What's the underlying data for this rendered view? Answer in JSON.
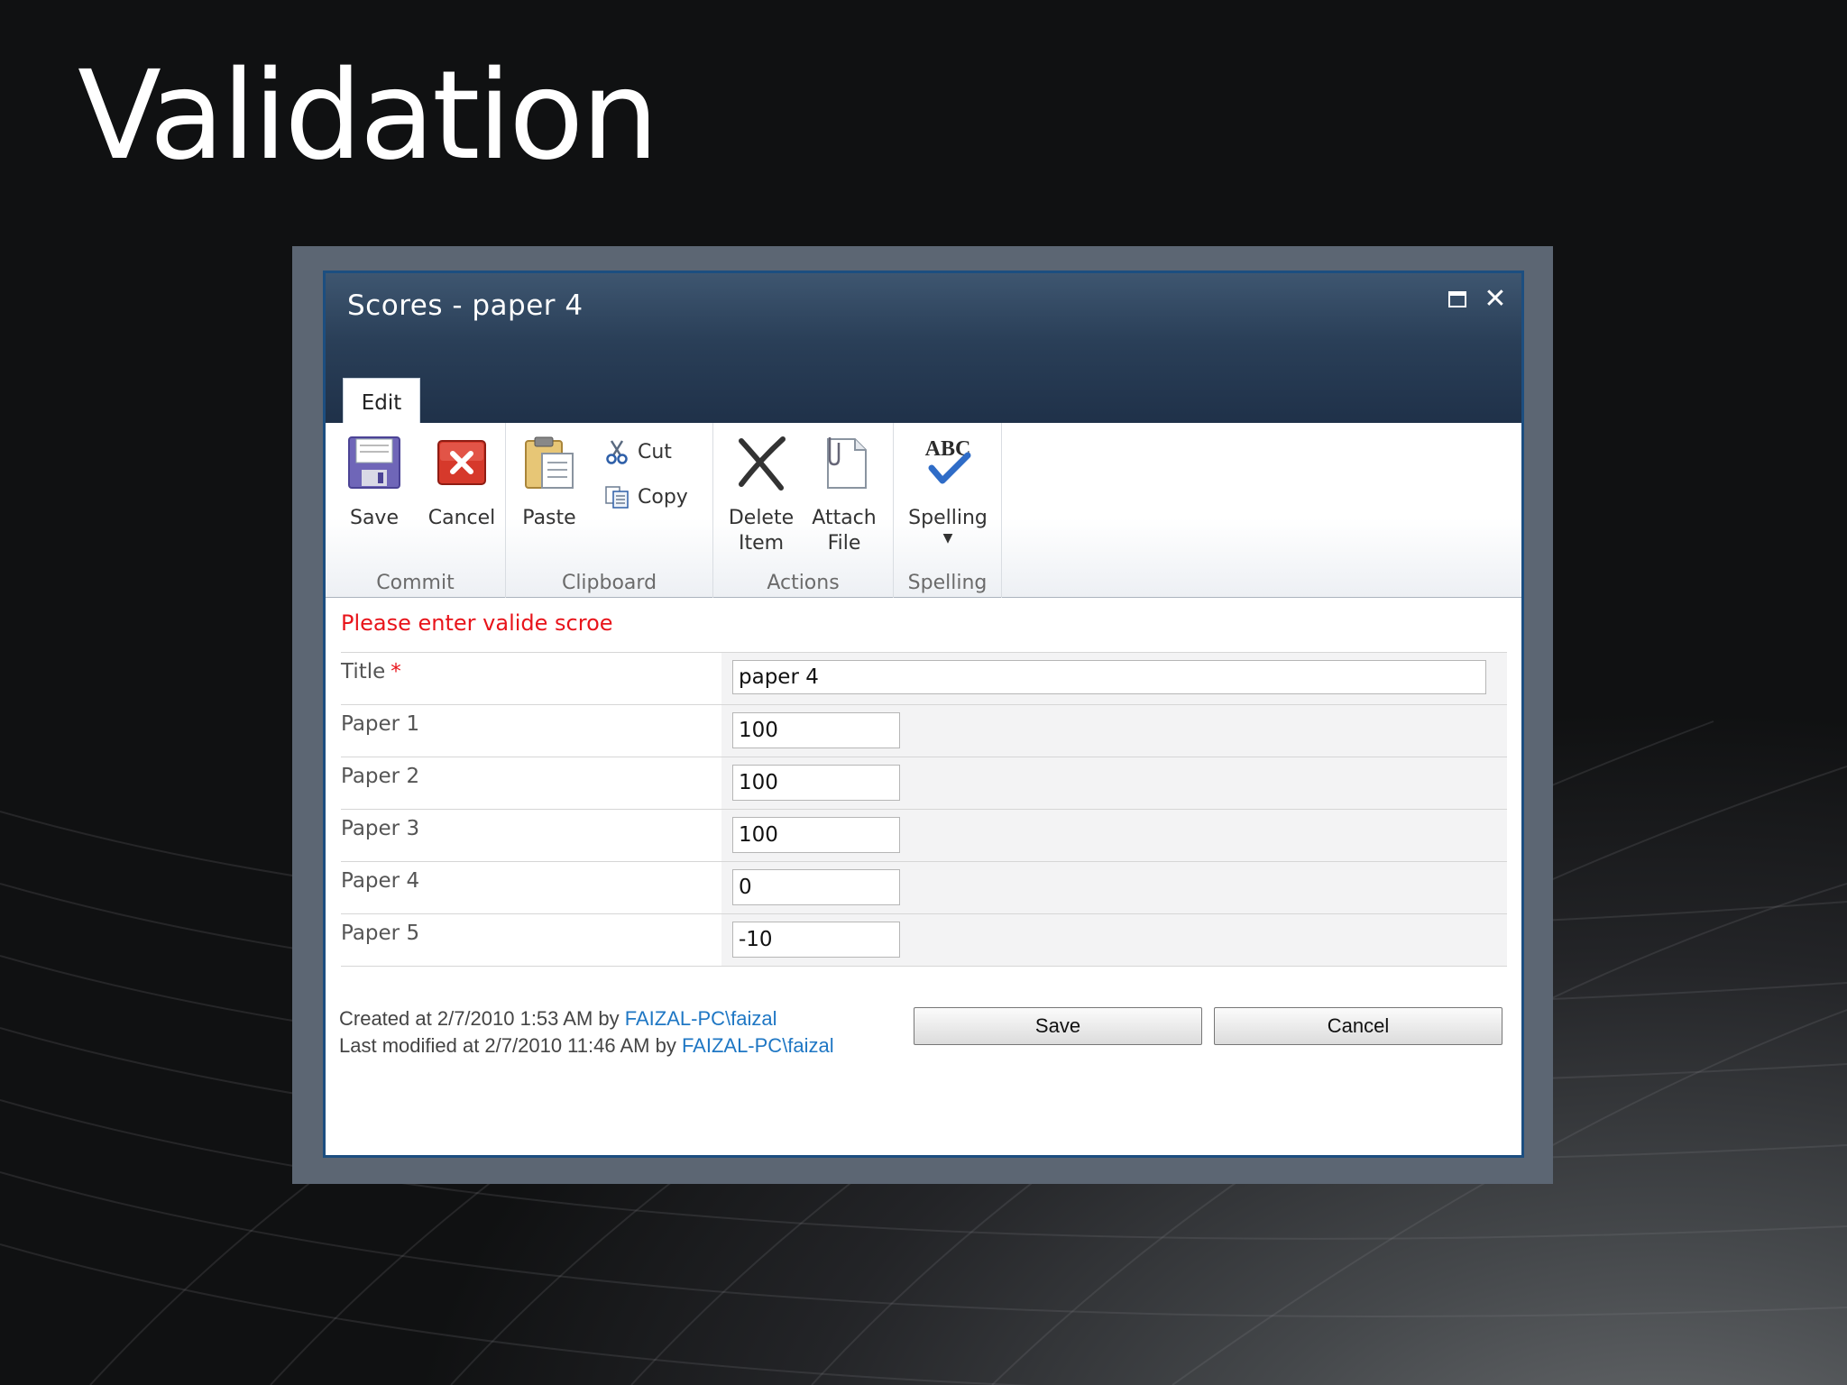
{
  "slide": {
    "title": "Validation"
  },
  "dialog": {
    "title": "Scores - paper 4",
    "maximize_icon": "maximize-icon",
    "close_icon": "close-icon"
  },
  "ribbon": {
    "active_tab": "Edit",
    "groups": {
      "commit": {
        "label": "Commit",
        "save": "Save",
        "cancel": "Cancel"
      },
      "clipboard": {
        "label": "Clipboard",
        "paste": "Paste",
        "cut": "Cut",
        "copy": "Copy"
      },
      "actions": {
        "label": "Actions",
        "delete_l1": "Delete",
        "delete_l2": "Item",
        "attach_l1": "Attach",
        "attach_l2": "File"
      },
      "spelling": {
        "label": "Spelling",
        "spelling": "Spelling",
        "icon_text": "ABC"
      }
    }
  },
  "form": {
    "error": "Please enter valide scroe",
    "required_mark": "*",
    "rows": [
      {
        "label": "Title",
        "value": "paper 4"
      },
      {
        "label": "Paper 1",
        "value": "100"
      },
      {
        "label": "Paper 2",
        "value": "100"
      },
      {
        "label": "Paper 3",
        "value": "100"
      },
      {
        "label": "Paper 4",
        "value": "0"
      },
      {
        "label": "Paper 5",
        "value": "-10"
      }
    ]
  },
  "footer": {
    "created_prefix": "Created at 2/7/2010 1:53 AM by ",
    "created_user": "FAIZAL-PC\\faizal",
    "modified_prefix": "Last modified at 2/7/2010 11:46 AM by ",
    "modified_user": "FAIZAL-PC\\faizal",
    "save": "Save",
    "cancel": "Cancel"
  },
  "colors": {
    "titlebar": "#2a3f58",
    "error": "#e8141b",
    "link": "#1f77c4",
    "dialog_border": "#1c4e80"
  }
}
